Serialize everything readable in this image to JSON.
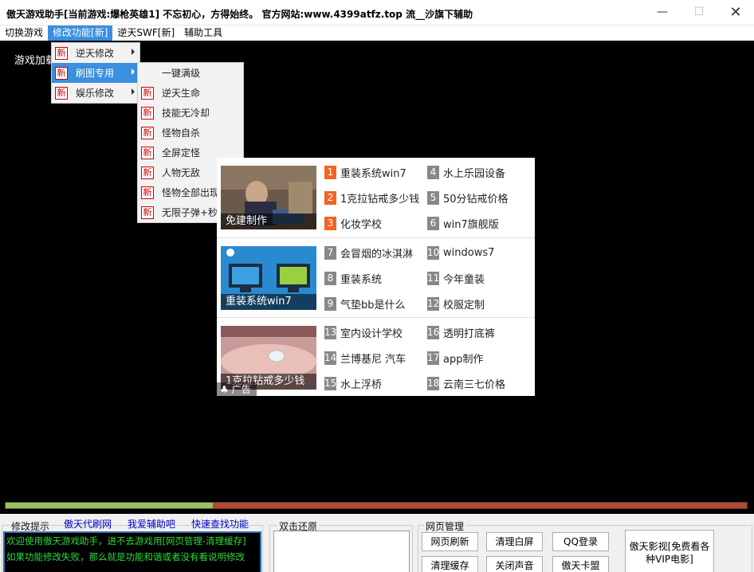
{
  "window": {
    "title": "傲天游戏助手[当前游戏:爆枪英雄1]     不忘初心，方得始终。  官方网站:www.4399atfz.top   流__沙旗下辅助",
    "minimize_glyph": "—",
    "maximize_glyph": "☐",
    "close_glyph": "✕"
  },
  "menubar": [
    "切换游戏",
    "修改功能[新]",
    "逆天SWF[新]",
    "辅助工具"
  ],
  "game": {
    "loading_text": "游戏加载"
  },
  "menu_main": [
    {
      "badge": "新",
      "label": "逆天修改"
    },
    {
      "badge": "新",
      "label": "刷图专用"
    },
    {
      "badge": "新",
      "label": "娱乐修改"
    }
  ],
  "menu_sub": [
    {
      "badge": "",
      "label": "一键满级"
    },
    {
      "badge": "新",
      "label": "逆天生命"
    },
    {
      "badge": "新",
      "label": "技能无冷却"
    },
    {
      "badge": "新",
      "label": "怪物自杀"
    },
    {
      "badge": "新",
      "label": "全屏定怪"
    },
    {
      "badge": "新",
      "label": "人物无敌"
    },
    {
      "badge": "新",
      "label": "怪物全部出现"
    },
    {
      "badge": "新",
      "label": "无限子弹+秒杀"
    }
  ],
  "ad": {
    "sections": [
      {
        "caption": "免建制作",
        "items": [
          {
            "num": "1",
            "text": "重装系统win7"
          },
          {
            "num": "4",
            "text": "水上乐园设备"
          },
          {
            "num": "2",
            "text": "1克拉钻戒多少钱"
          },
          {
            "num": "5",
            "text": "50分钻戒价格"
          },
          {
            "num": "3",
            "text": "化妆学校"
          },
          {
            "num": "6",
            "text": "win7旗舰版"
          }
        ]
      },
      {
        "caption": "重装系统win7",
        "items": [
          {
            "num": "7",
            "text": "会冒烟的冰淇淋"
          },
          {
            "num": "10",
            "text": "windows7"
          },
          {
            "num": "8",
            "text": "重装系统"
          },
          {
            "num": "11",
            "text": "今年童装"
          },
          {
            "num": "9",
            "text": "气垫bb是什么"
          },
          {
            "num": "12",
            "text": "校服定制"
          }
        ]
      },
      {
        "caption": "1克拉钻戒多少钱",
        "items": [
          {
            "num": "13",
            "text": "室内设计学校"
          },
          {
            "num": "16",
            "text": "透明打底裤"
          },
          {
            "num": "14",
            "text": "兰博基尼 汽车"
          },
          {
            "num": "17",
            "text": "app制作"
          },
          {
            "num": "15",
            "text": "水上浮桥"
          },
          {
            "num": "18",
            "text": "云南三七价格"
          }
        ]
      }
    ],
    "pager": "♣ 广告",
    "hot_color": "#f26522"
  },
  "progress": {
    "fraction": 0.28
  },
  "bottom": {
    "modify_tip_label": "修改提示",
    "links": [
      "傲天代刷网",
      "我爱辅助吧",
      "快速查找功能"
    ],
    "console_lines": [
      "欢迎使用傲天游戏助手，进不去游戏用[网页管理-清理缓存]",
      "如果功能修改失败，那么就是功能和谐或者没有看说明修改"
    ],
    "restore_label": "双击还原",
    "web_label": "网页管理",
    "buttons": [
      "网页刷新",
      "清理白屏",
      "QQ登录",
      "清理缓存",
      "关闭声音",
      "傲天卡盟"
    ],
    "big_button": "傲天影视[免费看各种VIP电影]"
  }
}
